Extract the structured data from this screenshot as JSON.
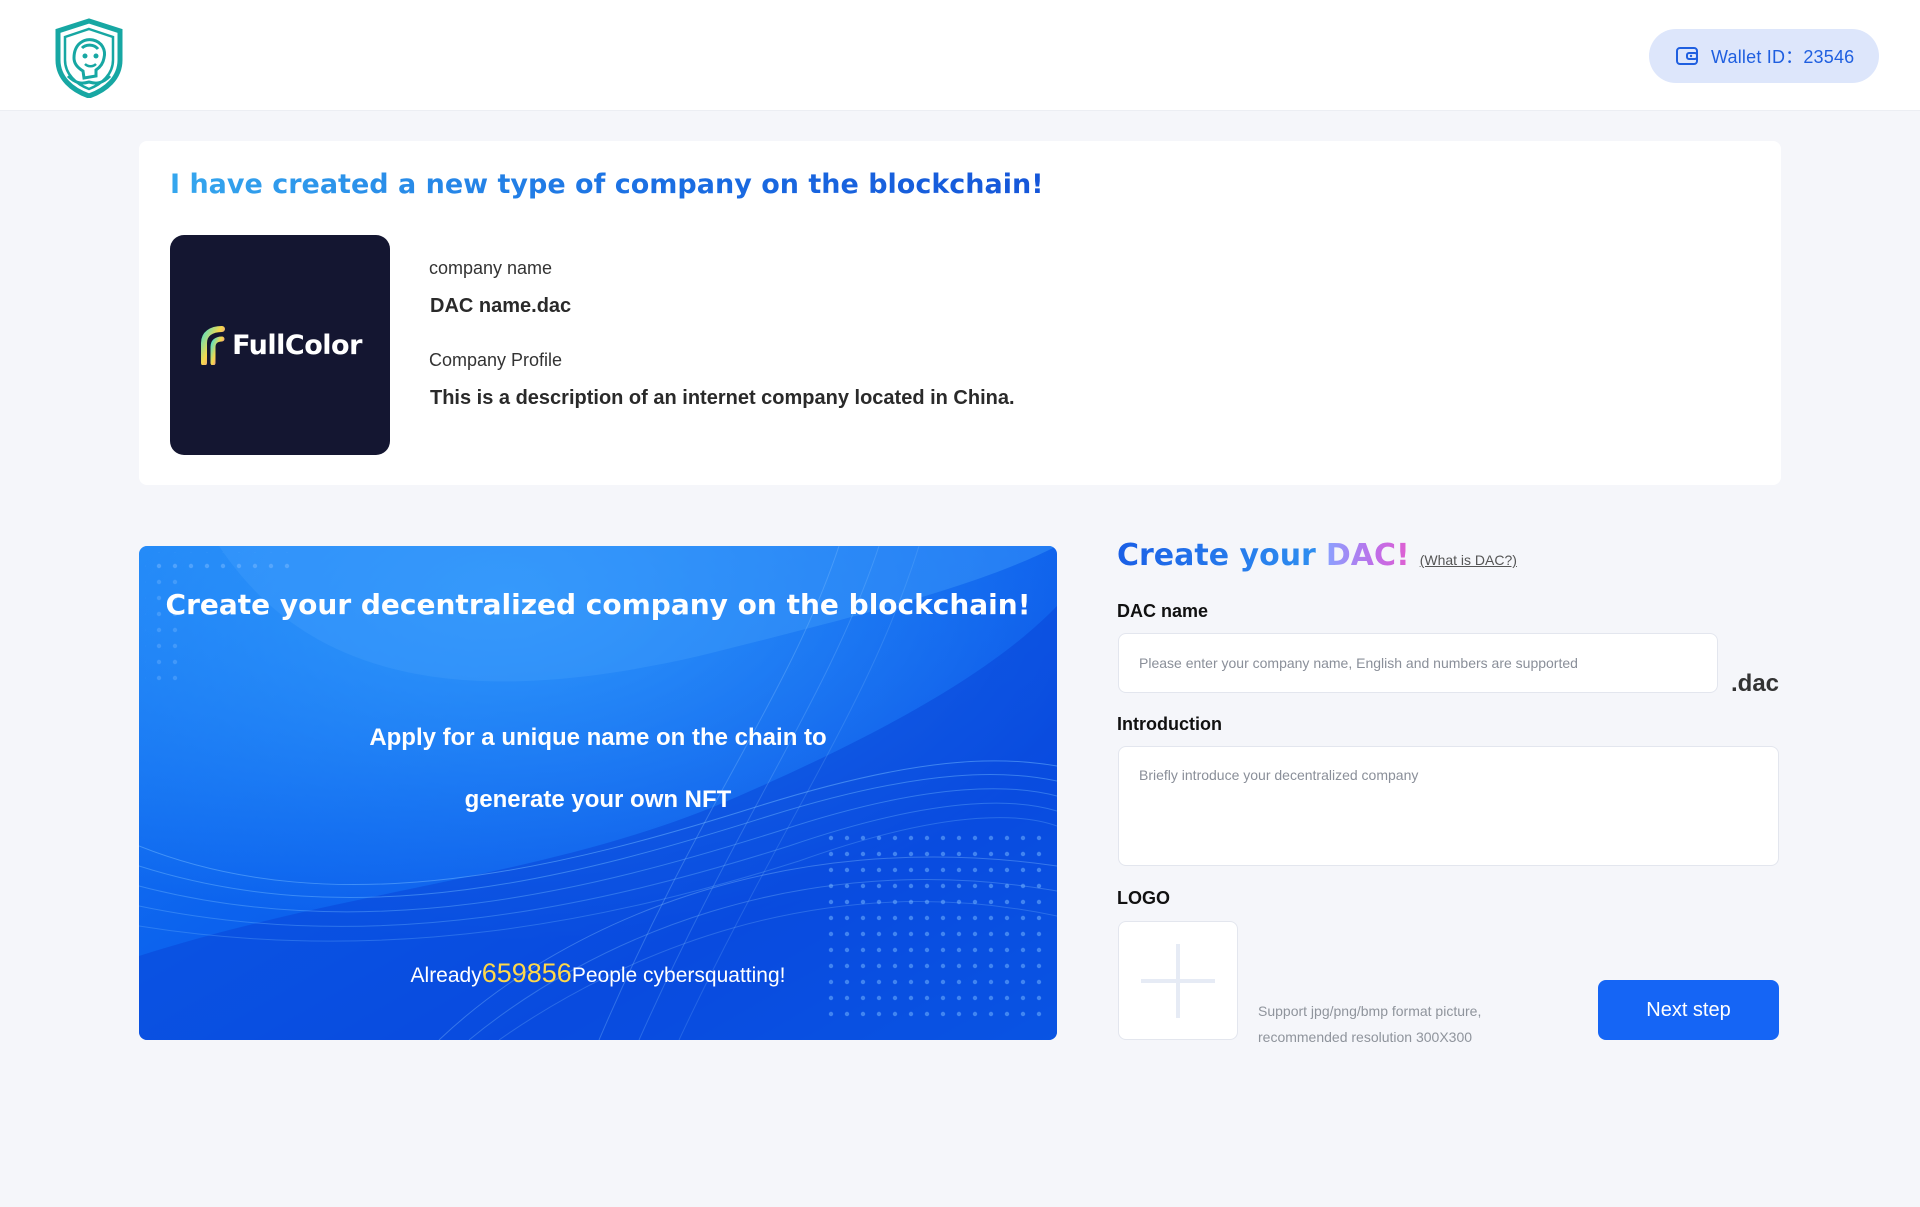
{
  "header": {
    "logo_icon": "shield-mascot-logo-icon",
    "wallet": {
      "icon": "wallet-icon",
      "label": "Wallet ID：23546"
    }
  },
  "company_card": {
    "title": "I have created a new type of company on the blockchain!",
    "logo": {
      "brand_name": "FullColor",
      "icon": "fullcolor-logo-icon",
      "background": "#141631"
    },
    "name_label": "company name",
    "name_value": "DAC name.dac",
    "profile_label": "Company Profile",
    "profile_value": "This is a description of an internet company located in China."
  },
  "banner": {
    "title": "Create your decentralized company on the blockchain!",
    "subtitle_line1": "Apply for a unique name on the chain to",
    "subtitle_line2": "generate your own NFT",
    "count_prefix": "Already",
    "count_value": "659856",
    "count_suffix": "People cybersquatting!"
  },
  "form": {
    "title_part1": "Create your",
    "title_part2": "DAC!",
    "help_link": "(What is DAC?)",
    "dac_name_label": "DAC name",
    "dac_name_value": "",
    "dac_name_placeholder": "Please enter your company name, English and numbers are supported",
    "dac_suffix": ".dac",
    "intro_label": "Introduction",
    "intro_value": "",
    "intro_placeholder": "Briefly introduce your decentralized company",
    "logo_label": "LOGO",
    "upload_icon": "plus-icon",
    "upload_hint_line1": "Support jpg/png/bmp format picture,",
    "upload_hint_line2": "recommended resolution 300X300",
    "next_button": "Next step"
  },
  "colors": {
    "primary": "#1565f5",
    "page_background": "#f5f6fa",
    "wallet_pill": "#dde6fb",
    "count_highlight": "#ffd84a"
  }
}
